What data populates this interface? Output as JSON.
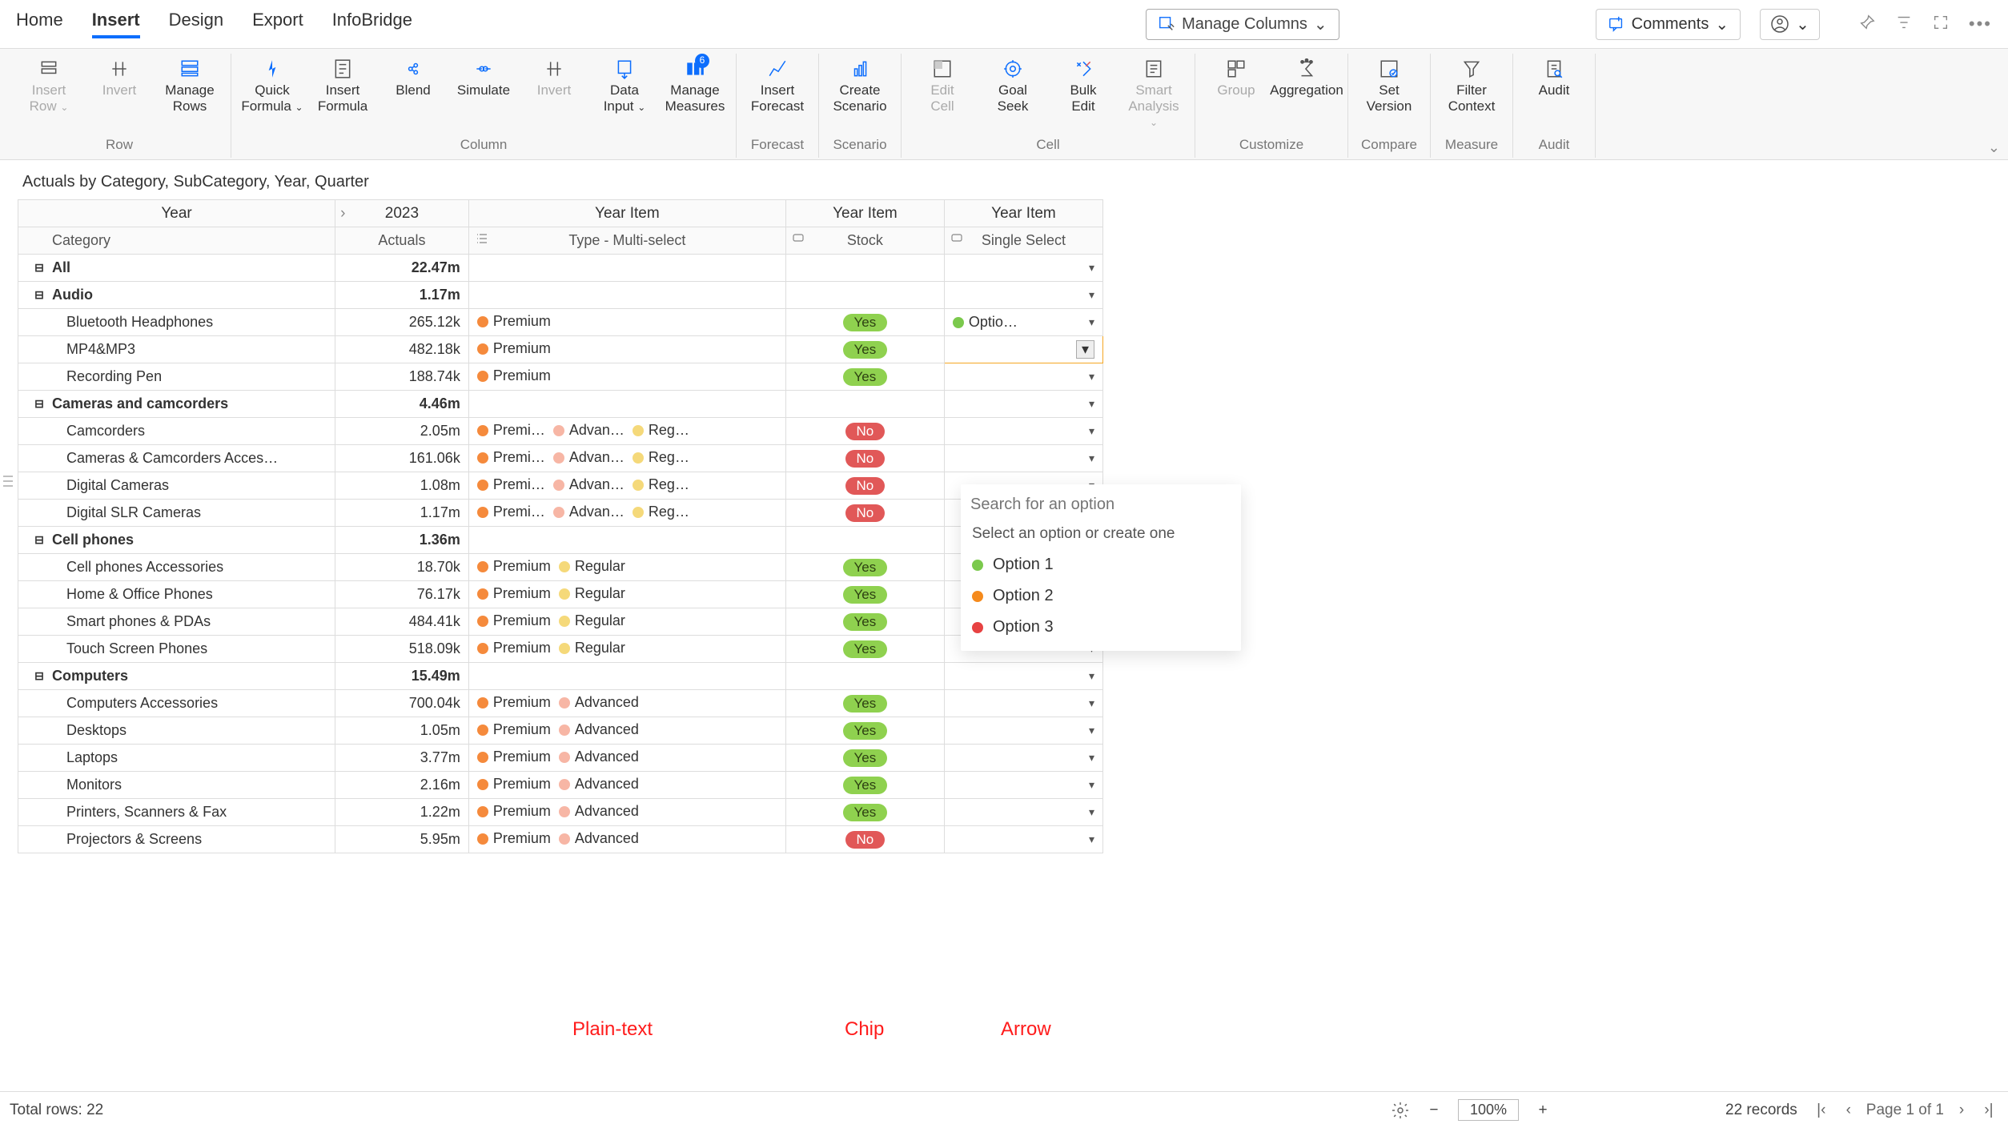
{
  "tabs": {
    "home": "Home",
    "insert": "Insert",
    "design": "Design",
    "export": "Export",
    "infobridge": "InfoBridge",
    "active": "insert"
  },
  "manage_columns": "Manage Columns",
  "comments": "Comments",
  "ribbon": {
    "groups": [
      {
        "label": "Row",
        "items": [
          {
            "id": "insert-row",
            "l1": "Insert",
            "l2": "Row",
            "disabled": true,
            "dd": true
          },
          {
            "id": "invert-row",
            "l1": "Invert",
            "l2": "",
            "disabled": true
          },
          {
            "id": "manage-rows",
            "l1": "Manage",
            "l2": "Rows"
          }
        ]
      },
      {
        "label": "Column",
        "items": [
          {
            "id": "quick-formula",
            "l1": "Quick",
            "l2": "Formula",
            "dd": true
          },
          {
            "id": "insert-formula",
            "l1": "Insert",
            "l2": "Formula"
          },
          {
            "id": "blend",
            "l1": "Blend",
            "l2": ""
          },
          {
            "id": "simulate",
            "l1": "Simulate",
            "l2": ""
          },
          {
            "id": "invert-col",
            "l1": "Invert",
            "l2": "",
            "disabled": true
          },
          {
            "id": "data-input",
            "l1": "Data",
            "l2": "Input",
            "dd": true
          },
          {
            "id": "manage-measures",
            "l1": "Manage",
            "l2": "Measures",
            "badge": "6"
          }
        ]
      },
      {
        "label": "Forecast",
        "items": [
          {
            "id": "insert-forecast",
            "l1": "Insert",
            "l2": "Forecast"
          }
        ]
      },
      {
        "label": "Scenario",
        "items": [
          {
            "id": "create-scenario",
            "l1": "Create",
            "l2": "Scenario"
          }
        ]
      },
      {
        "label": "Cell",
        "items": [
          {
            "id": "edit-cell",
            "l1": "Edit",
            "l2": "Cell",
            "disabled": true
          },
          {
            "id": "goal-seek",
            "l1": "Goal",
            "l2": "Seek"
          },
          {
            "id": "bulk-edit",
            "l1": "Bulk",
            "l2": "Edit"
          },
          {
            "id": "smart-analysis",
            "l1": "Smart",
            "l2": "Analysis",
            "disabled": true,
            "dd": true
          }
        ]
      },
      {
        "label": "Customize",
        "items": [
          {
            "id": "group",
            "l1": "Group",
            "l2": "",
            "disabled": true
          },
          {
            "id": "aggregation",
            "l1": "Aggregation",
            "l2": ""
          }
        ]
      },
      {
        "label": "Compare",
        "items": [
          {
            "id": "set-version",
            "l1": "Set",
            "l2": "Version"
          }
        ]
      },
      {
        "label": "Measure",
        "items": [
          {
            "id": "filter-context",
            "l1": "Filter",
            "l2": "Context"
          }
        ]
      },
      {
        "label": "Audit",
        "items": [
          {
            "id": "audit",
            "l1": "Audit",
            "l2": ""
          }
        ]
      }
    ]
  },
  "table_title": "Actuals by Category, SubCategory, Year, Quarter",
  "header": {
    "year": "Year",
    "year_val": "2023",
    "year_item": "Year Item",
    "category": "Category",
    "actuals": "Actuals",
    "type_sub": "Type - Multi-select",
    "stock_sub": "Stock",
    "single_sub": "Single Select"
  },
  "rows": [
    {
      "kind": "cat",
      "name": "All",
      "val": "22.47m"
    },
    {
      "kind": "cat",
      "name": "Audio",
      "val": "1.17m"
    },
    {
      "kind": "sub",
      "name": "Bluetooth Headphones",
      "val": "265.12k",
      "types": [
        {
          "c": "orange",
          "t": "Premium"
        }
      ],
      "stock": "Yes",
      "sel": {
        "c": "green",
        "t": "Optio…",
        "dd": true
      }
    },
    {
      "kind": "sub",
      "name": "MP4&MP3",
      "val": "482.18k",
      "types": [
        {
          "c": "orange",
          "t": "Premium"
        }
      ],
      "stock": "Yes",
      "active": true
    },
    {
      "kind": "sub",
      "name": "Recording Pen",
      "val": "188.74k",
      "types": [
        {
          "c": "orange",
          "t": "Premium"
        }
      ],
      "stock": "Yes"
    },
    {
      "kind": "cat",
      "name": "Cameras and camcorders",
      "val": "4.46m"
    },
    {
      "kind": "sub",
      "name": "Camcorders",
      "val": "2.05m",
      "types": [
        {
          "c": "orange",
          "t": "Premi…"
        },
        {
          "c": "pink",
          "t": "Advan…"
        },
        {
          "c": "yellow",
          "t": "Reg…"
        }
      ],
      "stock": "No"
    },
    {
      "kind": "sub",
      "name": "Cameras & Camcorders Acces…",
      "val": "161.06k",
      "types": [
        {
          "c": "orange",
          "t": "Premi…"
        },
        {
          "c": "pink",
          "t": "Advan…"
        },
        {
          "c": "yellow",
          "t": "Reg…"
        }
      ],
      "stock": "No"
    },
    {
      "kind": "sub",
      "name": "Digital Cameras",
      "val": "1.08m",
      "types": [
        {
          "c": "orange",
          "t": "Premi…"
        },
        {
          "c": "pink",
          "t": "Advan…"
        },
        {
          "c": "yellow",
          "t": "Reg…"
        }
      ],
      "stock": "No"
    },
    {
      "kind": "sub",
      "name": "Digital SLR Cameras",
      "val": "1.17m",
      "types": [
        {
          "c": "orange",
          "t": "Premi…"
        },
        {
          "c": "pink",
          "t": "Advan…"
        },
        {
          "c": "yellow",
          "t": "Reg…"
        }
      ],
      "stock": "No"
    },
    {
      "kind": "cat",
      "name": "Cell phones",
      "val": "1.36m"
    },
    {
      "kind": "sub",
      "name": "Cell phones Accessories",
      "val": "18.70k",
      "types": [
        {
          "c": "orange",
          "t": "Premium"
        },
        {
          "c": "yellow",
          "t": "Regular"
        }
      ],
      "stock": "Yes"
    },
    {
      "kind": "sub",
      "name": "Home & Office Phones",
      "val": "76.17k",
      "types": [
        {
          "c": "orange",
          "t": "Premium"
        },
        {
          "c": "yellow",
          "t": "Regular"
        }
      ],
      "stock": "Yes"
    },
    {
      "kind": "sub",
      "name": "Smart phones & PDAs",
      "val": "484.41k",
      "types": [
        {
          "c": "orange",
          "t": "Premium"
        },
        {
          "c": "yellow",
          "t": "Regular"
        }
      ],
      "stock": "Yes"
    },
    {
      "kind": "sub",
      "name": "Touch Screen Phones",
      "val": "518.09k",
      "types": [
        {
          "c": "orange",
          "t": "Premium"
        },
        {
          "c": "yellow",
          "t": "Regular"
        }
      ],
      "stock": "Yes"
    },
    {
      "kind": "cat",
      "name": "Computers",
      "val": "15.49m"
    },
    {
      "kind": "sub",
      "name": "Computers Accessories",
      "val": "700.04k",
      "types": [
        {
          "c": "orange",
          "t": "Premium"
        },
        {
          "c": "pink",
          "t": "Advanced"
        }
      ],
      "stock": "Yes"
    },
    {
      "kind": "sub",
      "name": "Desktops",
      "val": "1.05m",
      "types": [
        {
          "c": "orange",
          "t": "Premium"
        },
        {
          "c": "pink",
          "t": "Advanced"
        }
      ],
      "stock": "Yes"
    },
    {
      "kind": "sub",
      "name": "Laptops",
      "val": "3.77m",
      "types": [
        {
          "c": "orange",
          "t": "Premium"
        },
        {
          "c": "pink",
          "t": "Advanced"
        }
      ],
      "stock": "Yes"
    },
    {
      "kind": "sub",
      "name": "Monitors",
      "val": "2.16m",
      "types": [
        {
          "c": "orange",
          "t": "Premium"
        },
        {
          "c": "pink",
          "t": "Advanced"
        }
      ],
      "stock": "Yes"
    },
    {
      "kind": "sub",
      "name": "Printers, Scanners & Fax",
      "val": "1.22m",
      "types": [
        {
          "c": "orange",
          "t": "Premium"
        },
        {
          "c": "pink",
          "t": "Advanced"
        }
      ],
      "stock": "Yes"
    },
    {
      "kind": "sub",
      "name": "Projectors & Screens",
      "val": "5.95m",
      "types": [
        {
          "c": "orange",
          "t": "Premium"
        },
        {
          "c": "pink",
          "t": "Advanced"
        }
      ],
      "stock": "No"
    }
  ],
  "dropdown": {
    "placeholder": "Search for an option",
    "hint": "Select an option or create one",
    "options": [
      {
        "c": "green",
        "t": "Option 1"
      },
      {
        "c": "darkorange",
        "t": "Option 2"
      },
      {
        "c": "red",
        "t": "Option 3"
      }
    ]
  },
  "annotations": {
    "plain": "Plain-text",
    "chip": "Chip",
    "arrow": "Arrow"
  },
  "status": {
    "total_rows": "Total rows: 22",
    "zoom": "100%",
    "records": "22 records",
    "page": "Page 1 of 1"
  }
}
